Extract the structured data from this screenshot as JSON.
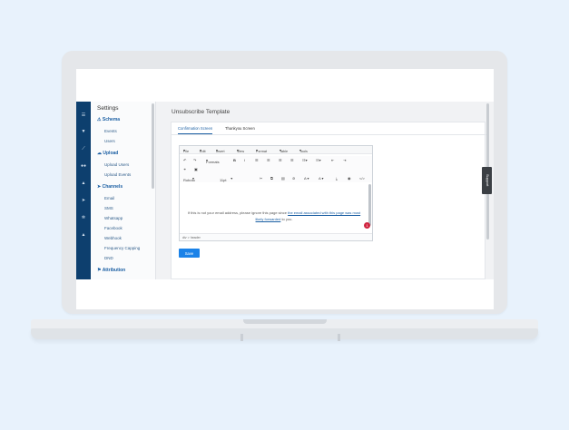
{
  "iconbar": {
    "icons": [
      "menu-icon",
      "filter-icon",
      "chart-icon",
      "users-icon",
      "upload-icon",
      "send-icon",
      "gear-icon",
      "alert-icon"
    ]
  },
  "sidebar": {
    "title": "Settings",
    "sections": [
      {
        "label": "Schema",
        "items": [
          "Events",
          "Users"
        ]
      },
      {
        "label": "Upload",
        "items": [
          "Upload Users",
          "Upload Events"
        ]
      },
      {
        "label": "Channels",
        "items": [
          "Email",
          "SMS",
          "Whatsapp",
          "Facebook",
          "Webhook",
          "Frequency Capping",
          "DND"
        ]
      },
      {
        "label": "Attribution",
        "items": []
      }
    ]
  },
  "main": {
    "title": "Unsubscribe Template",
    "tabs": [
      "Confirmation Screen",
      "Thankyou Screen"
    ],
    "editor": {
      "menus": [
        "File",
        "Edit",
        "Insert",
        "View",
        "Format",
        "Table",
        "Tools"
      ],
      "formats_label": "Formats",
      "font": "Roboto",
      "size": "11pt",
      "paragraph_start": "If this is not your email address, please ignore this page since ",
      "paragraph_link": "the email associated with this page was most likely forwarded",
      "paragraph_end": " to you.",
      "badge": "1",
      "status_path": "div > header"
    },
    "save_label": "Save",
    "support_label": "Support"
  }
}
